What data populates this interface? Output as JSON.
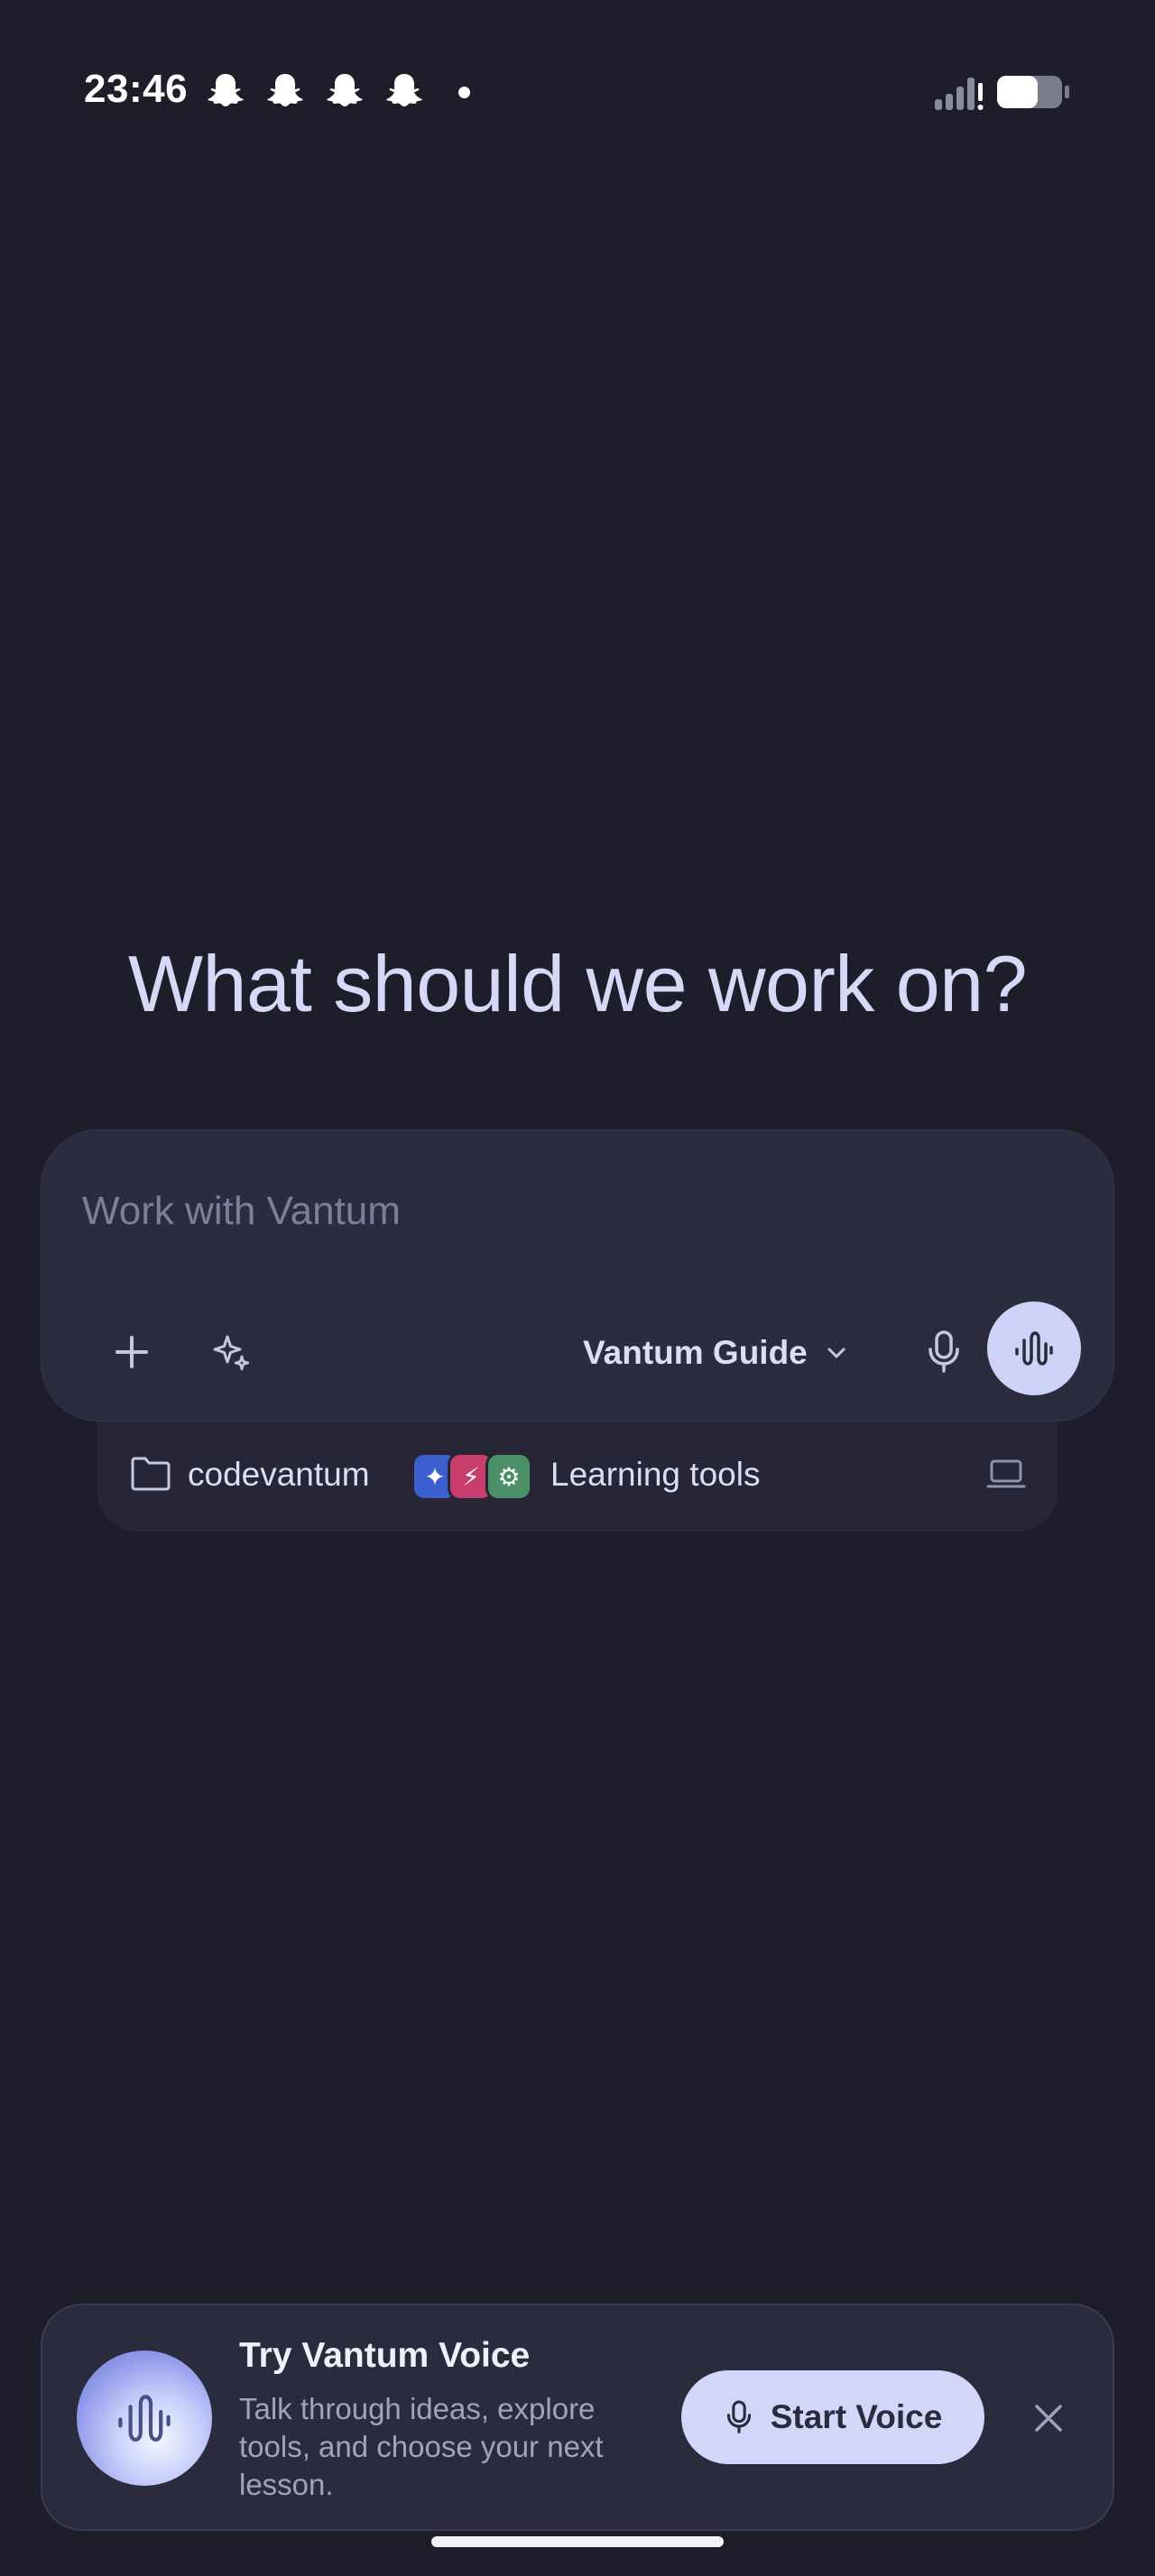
{
  "status_bar": {
    "time": "23:46",
    "notification_icons": [
      "snapchat-ghost",
      "snapchat-ghost",
      "snapchat-ghost",
      "snapchat-ghost"
    ],
    "battery_level": 0.62
  },
  "main": {
    "headline": "What should we work on?"
  },
  "composer": {
    "placeholder": "Work with Vantum",
    "value": "",
    "model": "Vantum Guide",
    "icons": [
      "plus-icon",
      "sparkle-icon",
      "chevron-down-icon",
      "microphone-icon",
      "waveform-icon"
    ]
  },
  "context": {
    "project": "codevantum",
    "tools_label": "Learning tools",
    "tool_chips": [
      "✦",
      "⚡",
      "⚙"
    ]
  },
  "voice_promo": {
    "title": "Try Vantum Voice",
    "description": "Talk through ideas, explore tools, and choose your next lesson.",
    "button_label": "Start Voice"
  },
  "colors": {
    "background": "#1e1e2b",
    "surface": "#2c2c3f",
    "accent": "#cfd2f7",
    "headline": "#d6d8f7"
  }
}
